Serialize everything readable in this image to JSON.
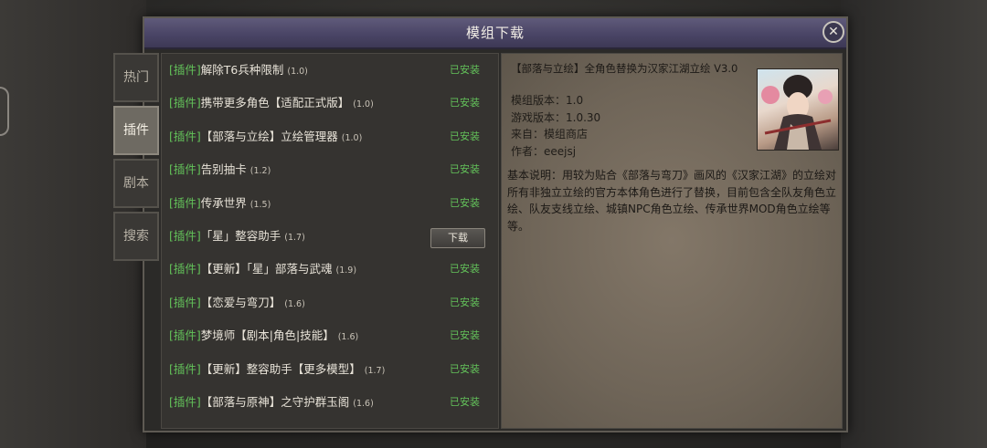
{
  "window": {
    "title": "模组下载"
  },
  "tabs": [
    {
      "label": "热门"
    },
    {
      "label": "插件"
    },
    {
      "label": "剧本"
    },
    {
      "label": "搜索"
    }
  ],
  "mods": [
    {
      "tag": "[插件]",
      "name": "解除T6兵种限制",
      "version": "(1.0)",
      "status": "已安装"
    },
    {
      "tag": "[插件]",
      "name": "携带更多角色【适配正式版】",
      "version": "(1.0)",
      "status": "已安装"
    },
    {
      "tag": "[插件]",
      "name": "【部落与立绘】立绘管理器",
      "version": "(1.0)",
      "status": "已安装"
    },
    {
      "tag": "[插件]",
      "name": "告别抽卡",
      "version": "(1.2)",
      "status": "已安装"
    },
    {
      "tag": "[插件]",
      "name": "传承世界",
      "version": "(1.5)",
      "status": "已安装"
    },
    {
      "tag": "[插件]",
      "name": "「星」整容助手",
      "version": "(1.7)",
      "button": "下载"
    },
    {
      "tag": "[插件]",
      "name": "【更新】「星」部落与武魂",
      "version": "(1.9)",
      "status": "已安装"
    },
    {
      "tag": "[插件]",
      "name": "【恋爱与弯刀】",
      "version": "(1.6)",
      "status": "已安装"
    },
    {
      "tag": "[插件]",
      "name": "梦境师【剧本|角色|技能】",
      "version": "(1.6)",
      "status": "已安装"
    },
    {
      "tag": "[插件]",
      "name": "【更新】整容助手【更多模型】",
      "version": "(1.7)",
      "status": "已安装"
    },
    {
      "tag": "[插件]",
      "name": "【部落与原神】之守护群玉阁",
      "version": "(1.6)",
      "status": "已安装"
    }
  ],
  "detail": {
    "title": "【部落与立绘】全角色替换为汉家江湖立绘 V3.0",
    "mod_version": "模组版本：1.0",
    "game_version": "游戏版本：1.0.30",
    "source": "来自：模组商店",
    "author": "作者：eeejsj",
    "description": "基本说明：用较为贴合《部落与弯刀》画风的《汉家江湖》的立绘对所有非独立立绘的官方本体角色进行了替换，目前包含全队友角色立绘、队友支线立绘、城镇NPC角色立绘、传承世界MOD角色立绘等等。"
  },
  "icons": {
    "close": "close-icon",
    "portrait": "character-portrait"
  }
}
